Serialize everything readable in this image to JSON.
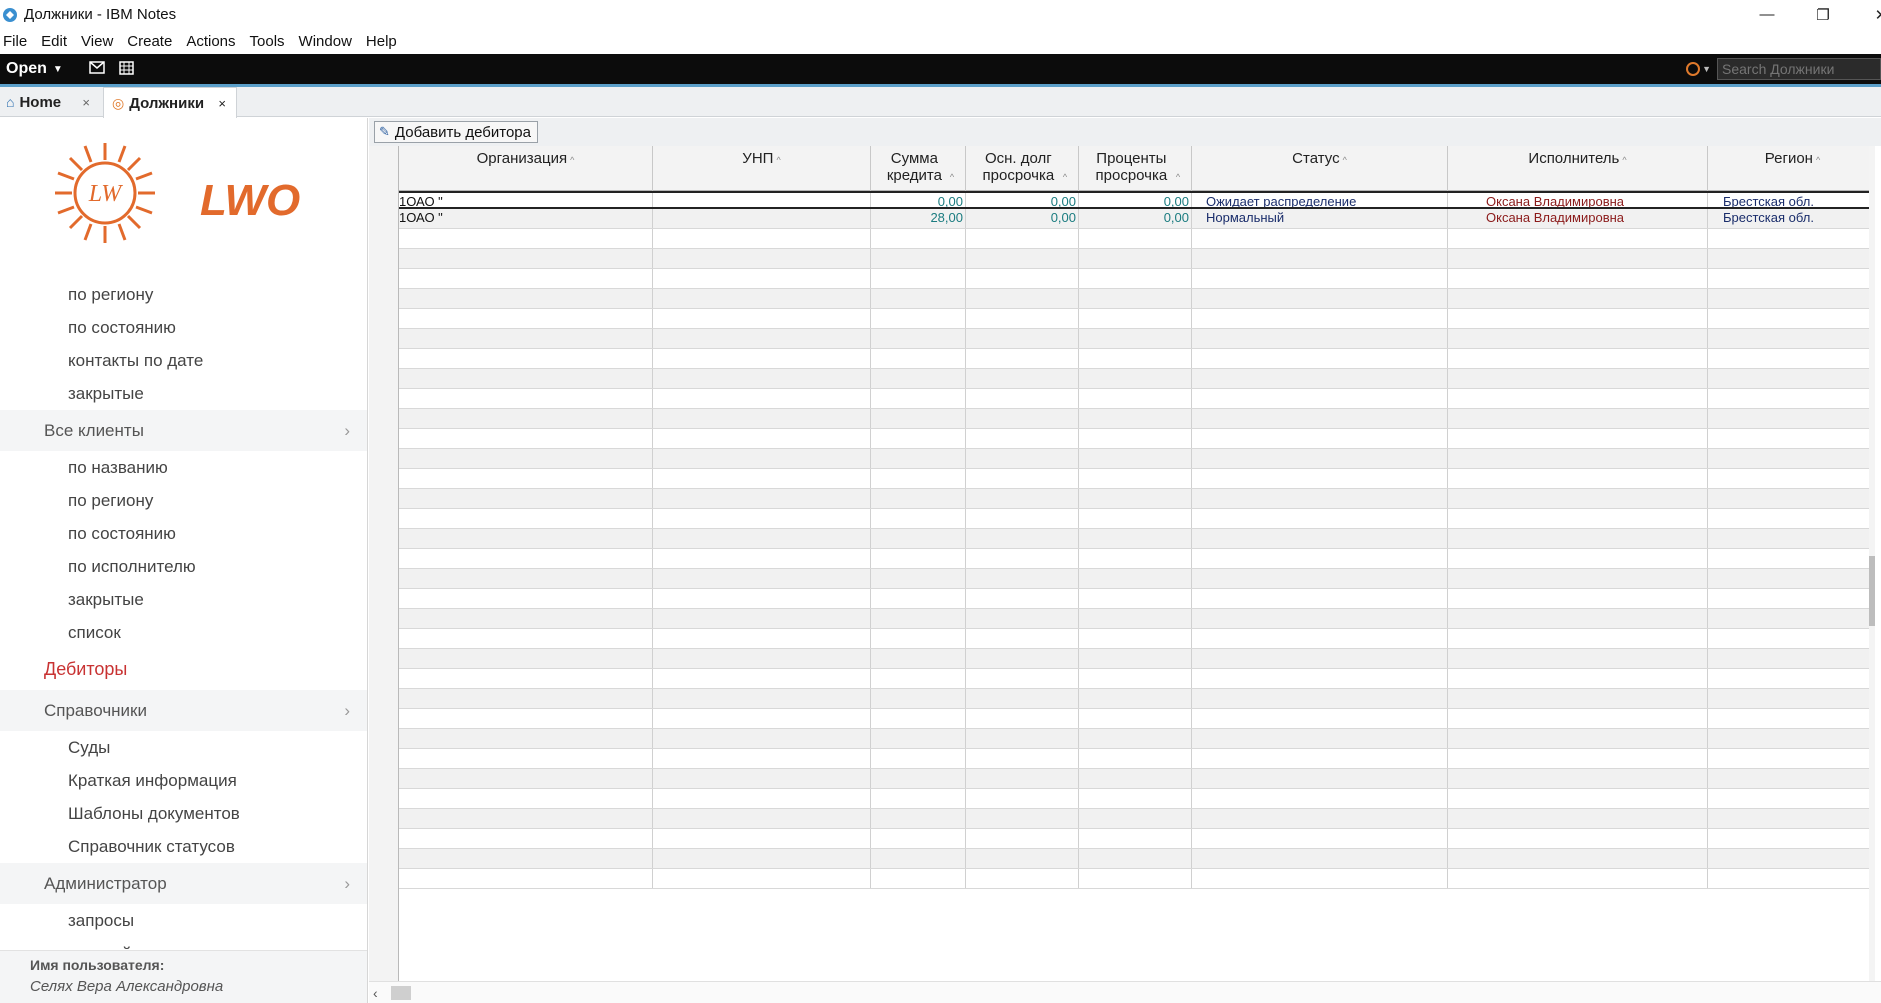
{
  "window": {
    "title": "Должники - IBM Notes",
    "minimize": "—",
    "maximize": "❐",
    "close": "✕"
  },
  "menu": [
    "File",
    "Edit",
    "View",
    "Create",
    "Actions",
    "Tools",
    "Window",
    "Help"
  ],
  "toolbar": {
    "open_label": "Open",
    "search_placeholder": "Search Должники"
  },
  "tabs": [
    {
      "label": "Home",
      "icon": "home-icon",
      "close": "×"
    },
    {
      "label": "Должники",
      "icon": "app-icon",
      "close": "×"
    }
  ],
  "logo": {
    "text": "LWO"
  },
  "sidebar": {
    "items": [
      {
        "type": "sub",
        "label": "по региону"
      },
      {
        "type": "sub",
        "label": "по состоянию"
      },
      {
        "type": "sub",
        "label": "контакты по дате"
      },
      {
        "type": "sub",
        "label": "закрытые"
      },
      {
        "type": "group",
        "label": "Все клиенты"
      },
      {
        "type": "sub",
        "label": "по названию"
      },
      {
        "type": "sub",
        "label": "по региону"
      },
      {
        "type": "sub",
        "label": "по состоянию"
      },
      {
        "type": "sub",
        "label": "по исполнителю"
      },
      {
        "type": "sub",
        "label": "закрытые"
      },
      {
        "type": "sub",
        "label": "список"
      },
      {
        "type": "active",
        "label": "Дебиторы"
      },
      {
        "type": "group",
        "label": "Справочники"
      },
      {
        "type": "sub",
        "label": "Суды"
      },
      {
        "type": "sub",
        "label": "Краткая информация"
      },
      {
        "type": "sub",
        "label": "Шаблоны документов"
      },
      {
        "type": "sub",
        "label": "Справочник статусов"
      },
      {
        "type": "group",
        "label": "Администратор"
      },
      {
        "type": "sub",
        "label": "запросы"
      },
      {
        "type": "sub",
        "label": "настройка"
      }
    ],
    "user_label": "Имя пользователя:",
    "user_name": "Селях Вера Александровна"
  },
  "actions": {
    "add_debtor": "Добавить дебитора"
  },
  "table": {
    "columns": [
      {
        "label": "Организация",
        "sortable": true
      },
      {
        "label": "УНП",
        "sortable": true
      },
      {
        "label": "Сумма кредита",
        "sortable": true
      },
      {
        "label": "Осн. долг просрочка",
        "sortable": true
      },
      {
        "label": "Проценты просрочка",
        "sortable": true
      },
      {
        "label": "Статус",
        "sortable": true
      },
      {
        "label": "Исполнитель",
        "sortable": true
      },
      {
        "label": "Регион",
        "sortable": true
      }
    ],
    "rows": [
      {
        "org": "1ОАО \"",
        "unp": "",
        "credit": "0,00",
        "debt": "0,00",
        "interest": "0,00",
        "status": "Ожидает распределение",
        "executor": "Оксана Владимировна",
        "region": "Брестская обл."
      },
      {
        "org": "1ОАО \"",
        "unp": "",
        "credit": "28,00",
        "debt": "0,00",
        "interest": "0,00",
        "status": "Нормальный",
        "executor": "Оксана Владимировна",
        "region": "Брестская обл."
      }
    ],
    "sort_glyph": "^"
  }
}
